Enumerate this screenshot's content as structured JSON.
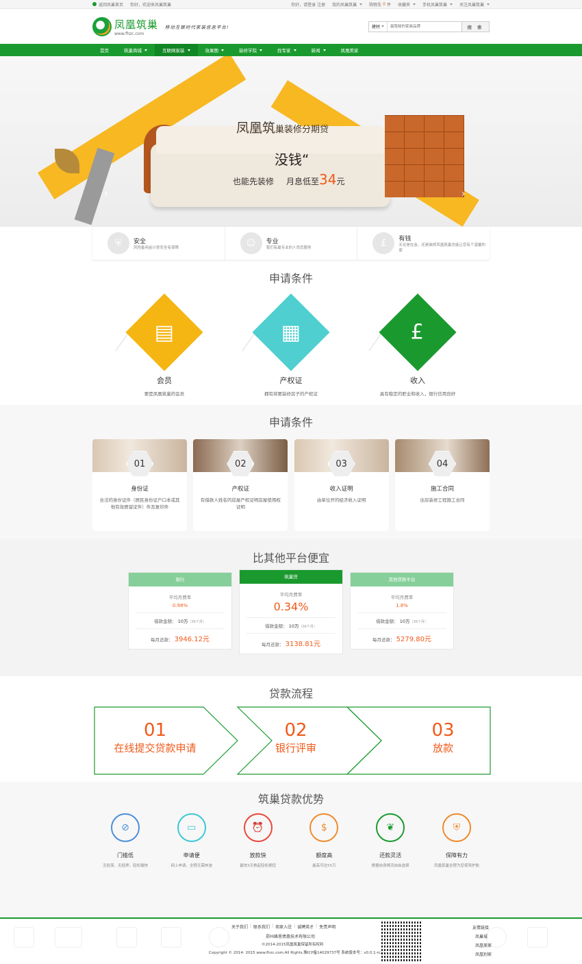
{
  "topbar": {
    "home_link": "返回凤巢首页",
    "welcome": "你好，欢迎来凤巢筑巢",
    "login": "你好，请登录 注册",
    "my_account": "我的凤巢筑巢",
    "cart": "购物车",
    "cart_count": "0",
    "cart_suffix": "件",
    "favorites": "收藏夹",
    "mobile": "手机凤巢筑巢",
    "follow": "关注凤巢筑巢"
  },
  "header": {
    "logo_cn": "凤凰筑巢",
    "logo_url": "www.fhzc.com",
    "slogan": "移动互联时代家装信息平台!",
    "search_category": "建材",
    "search_placeholder": "最隐秘的家装品牌",
    "search_button": "搜 索"
  },
  "nav": [
    {
      "label": "首页",
      "dropdown": false
    },
    {
      "label": "筑巢商城",
      "dropdown": true
    },
    {
      "label": "互联网家装",
      "dropdown": true
    },
    {
      "label": "效果图",
      "dropdown": true
    },
    {
      "label": "装修学院",
      "dropdown": true
    },
    {
      "label": "找专家",
      "dropdown": true
    },
    {
      "label": "新闻",
      "dropdown": true
    },
    {
      "label": "凤凰美家",
      "dropdown": false
    }
  ],
  "banner": {
    "title": "凤凰筑",
    "title_small": "巢装修分期贷",
    "money": "没钱“",
    "sub1": "也能先装修",
    "sub2": "月息低至",
    "rate": "34",
    "unit": "元"
  },
  "features": [
    {
      "title": "安全",
      "desc": "风险备用金计划安全有保障",
      "icon": "shield-icon"
    },
    {
      "title": "专业",
      "desc": "我们有最专业的人员您服务",
      "icon": "person-icon"
    },
    {
      "title": "有钱",
      "desc": "无论是在金，还是装修风凰筑巢总能让您有个温馨的家",
      "icon": "money-bag-icon"
    }
  ],
  "conditions1": {
    "title": "申请条件",
    "items": [
      {
        "title": "会员",
        "desc": "要是凤凰筑巢的会员",
        "color": "#f5b512",
        "icon": "member-card-icon"
      },
      {
        "title": "产权证",
        "desc": "拥有将要装修房子的产权证",
        "color": "#4fcfcf",
        "icon": "document-icon"
      },
      {
        "title": "收入",
        "desc": "具有稳定的职业和收入，银行信用良好",
        "color": "#1a9a2e",
        "icon": "money-bag-icon"
      }
    ]
  },
  "conditions2": {
    "title": "申请条件",
    "items": [
      {
        "num": "01",
        "title": "身份证",
        "desc": "合法的身份证件（居民身份证户口本或其他有效居留证件）件及复印件"
      },
      {
        "num": "02",
        "title": "产权证",
        "desc": "有借款人姓名的房屋产权证明房屋使用权证明"
      },
      {
        "num": "03",
        "title": "收入证明",
        "desc": "由单位开的经济收入证明"
      },
      {
        "num": "04",
        "title": "施工合同",
        "desc": "住房装修工程施工合同"
      }
    ]
  },
  "compare": {
    "title": "比其他平台便宜",
    "rate_label": "平均月费率",
    "loan_label": "借款金额：",
    "loan_value": "10万",
    "loan_term": "（36个月）",
    "repay_label": "每月还款：",
    "cards": [
      {
        "name": "银行",
        "rate": "0.98%",
        "repay": "3946.12元"
      },
      {
        "name": "筑巢贷",
        "rate": "0.34%",
        "repay": "3138.81元"
      },
      {
        "name": "其他贷款平台",
        "rate": "1.8%",
        "repay": "5279.80元"
      }
    ]
  },
  "process": {
    "title": "贷款流程",
    "steps": [
      {
        "num": "01",
        "label": "在线提交贷款申请"
      },
      {
        "num": "02",
        "label": "银行评审"
      },
      {
        "num": "03",
        "label": "放款"
      }
    ]
  },
  "advantages": {
    "title": "筑巢贷款优势",
    "items": [
      {
        "title": "门槛低",
        "desc": "无抵保、无抵押，轻松输快",
        "color": "#4a8fd8",
        "icon": "no-threshold-icon"
      },
      {
        "title": "申请便",
        "desc": "网上申请，全程无需奔波",
        "color": "#3cc7d6",
        "icon": "laptop-icon"
      },
      {
        "title": "放款快",
        "desc": "最快3天救起轻松拥您",
        "color": "#e8473a",
        "icon": "alarm-clock-icon"
      },
      {
        "title": "额度高",
        "desc": "最高可达55万",
        "color": "#f08a2a",
        "icon": "coins-icon"
      },
      {
        "title": "还款灵活",
        "desc": "根据自身情况自由选择",
        "color": "#1a9a2e",
        "icon": "leaf-icon"
      },
      {
        "title": "保障有力",
        "desc": "凤凰筑巢全程为您保驾护航",
        "color": "#f08a2a",
        "icon": "shield-icon"
      }
    ]
  },
  "footer": {
    "links": [
      "关于我们",
      "联系我们",
      "商家入驻",
      "诚聘英才",
      "免责声明"
    ],
    "company": "郑州峰恩债惠技术有限公司",
    "copy1": "©2014-2015凤凰筑巢保留所有权利",
    "copy2": "Copyright © 2014- 2015 www.fhzc.com.All Rights.豫ICP备14029737号 系统版本号：v0.0.1-rc22",
    "friend_title": "友情链接",
    "friend_links": [
      "凤巢城",
      "凤凰美家",
      "凤凰别家"
    ]
  }
}
